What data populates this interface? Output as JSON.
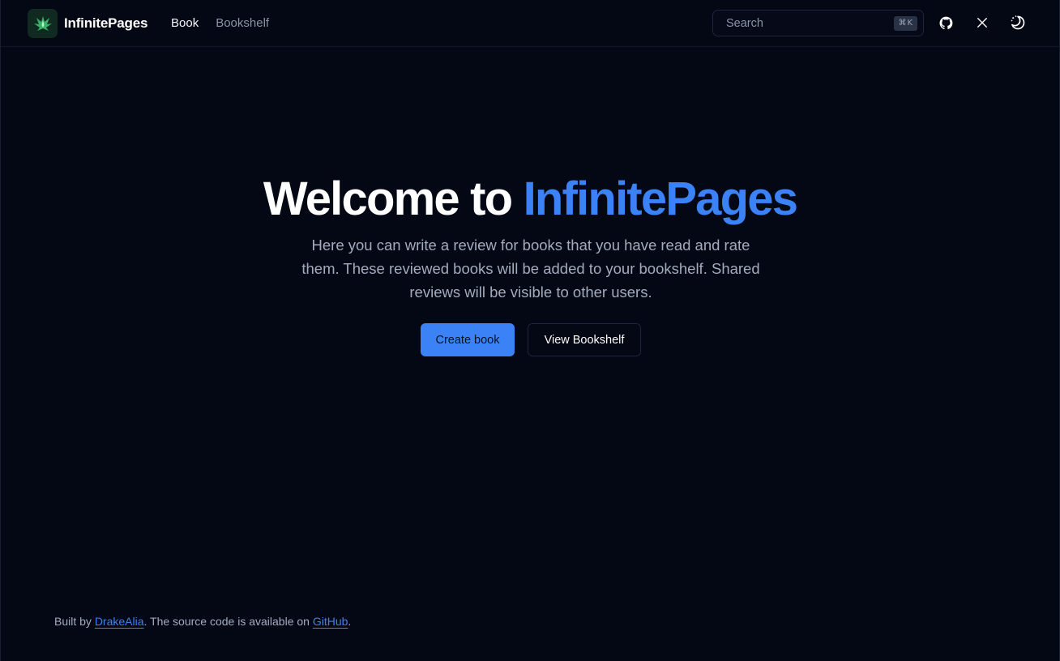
{
  "header": {
    "brand_name": "InfinitePages",
    "logo_icon": "dragon-logo-icon",
    "nav": [
      {
        "label": "Book"
      },
      {
        "label": "Bookshelf"
      }
    ],
    "search": {
      "placeholder": "Search",
      "shortcut": "⌘K"
    },
    "icons": [
      "github-icon",
      "x-icon",
      "theme-toggle-icon"
    ]
  },
  "hero": {
    "title_prefix": "Welcome to ",
    "title_accent": "InfinitePages",
    "description": "Here you can write a review for books that you have read and rate them. These reviewed books will be added to your bookshelf. Shared reviews will be visible to other users.",
    "primary_button": "Create book",
    "secondary_button": "View Bookshelf"
  },
  "footer": {
    "prefix": "Built by ",
    "author_link": "DrakeAlia",
    "middle": ". The source code is available on ",
    "source_link": "GitHub",
    "suffix": "."
  },
  "colors": {
    "background": "#040714",
    "accent": "#3b82f6",
    "muted_text": "#a3acbd"
  }
}
